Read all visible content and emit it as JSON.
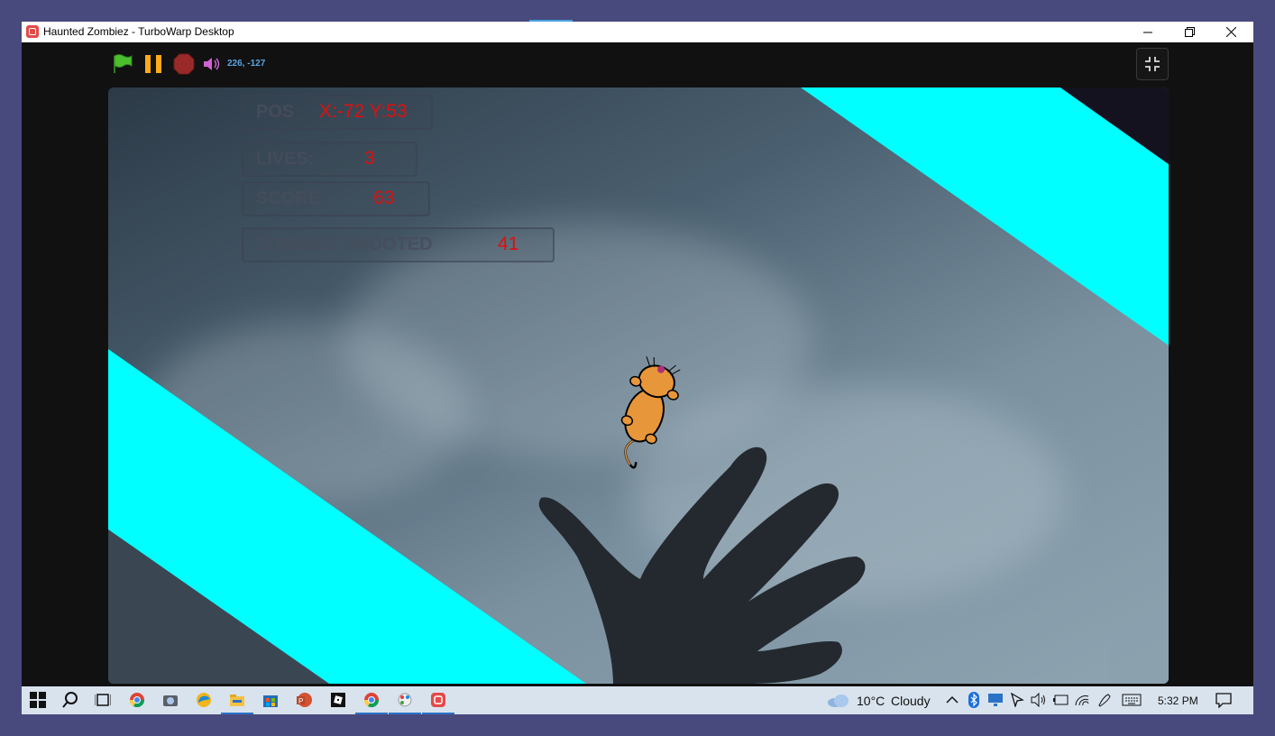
{
  "window": {
    "title": "Haunted Zombiez - TurboWarp Desktop",
    "controls": [
      "minimize",
      "restore",
      "close"
    ]
  },
  "toolbar": {
    "mouse_coords": "226, -127",
    "icons": [
      "green-flag-icon",
      "pause-icon",
      "stop-icon",
      "volume-icon",
      "exit-fullscreen-icon"
    ]
  },
  "stage": {
    "monitors": {
      "pos": {
        "label": "POS",
        "value": "X:-72 Y:53"
      },
      "lives": {
        "label": "LIVES:",
        "value": "3"
      },
      "score": {
        "label": "SCORE",
        "value": "63"
      },
      "zombies": {
        "label": "ZOMBIES SHOOTED",
        "value": "41"
      }
    },
    "colors": {
      "stripe": "#00ffff",
      "monitor_value": "#dd1010"
    }
  },
  "taskbar": {
    "apps": [
      "start-icon",
      "search-icon",
      "task-view-icon",
      "chrome-icon",
      "camera-icon",
      "edge-icon",
      "file-explorer-icon",
      "store-icon",
      "powerpoint-icon",
      "roblox-icon",
      "chrome-profile-icon",
      "paint-icon",
      "turbowarp-icon"
    ],
    "weather": {
      "temp": "10°C",
      "condition": "Cloudy"
    },
    "clock": "5:32 PM"
  }
}
